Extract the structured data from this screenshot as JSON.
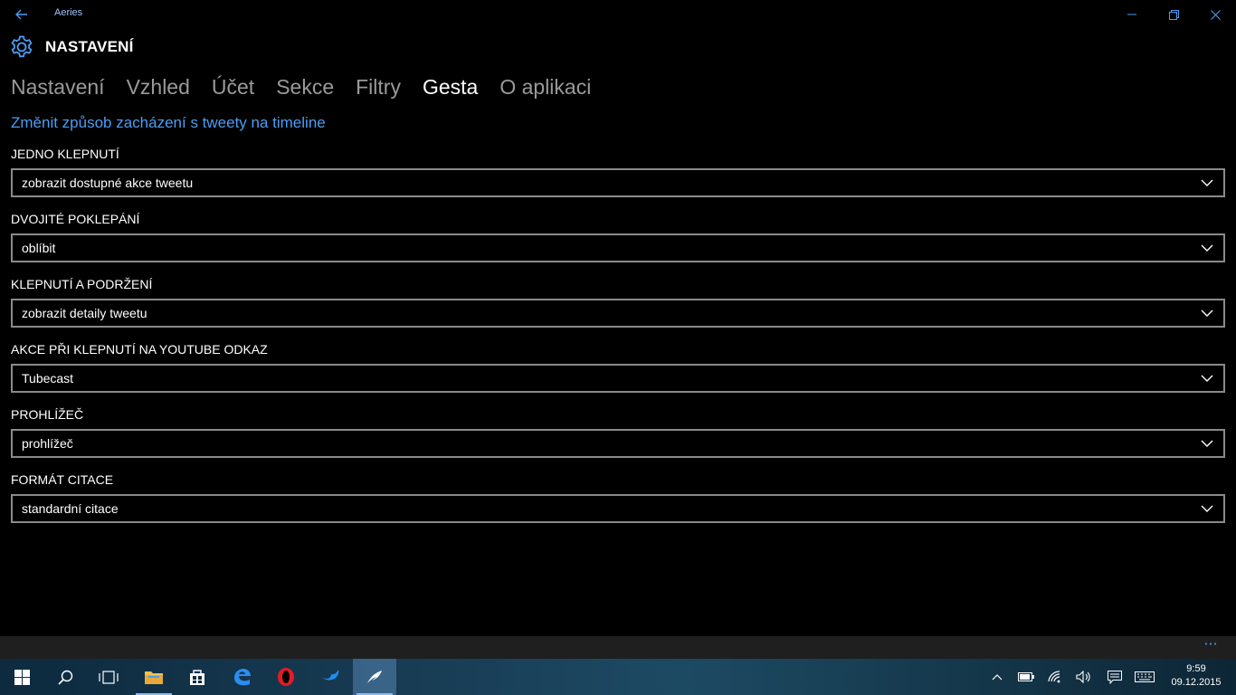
{
  "window": {
    "title": "Aeries"
  },
  "header": {
    "title": "NASTAVENÍ"
  },
  "tabs": [
    {
      "label": "Nastavení",
      "active": false
    },
    {
      "label": "Vzhled",
      "active": false
    },
    {
      "label": "Účet",
      "active": false
    },
    {
      "label": "Sekce",
      "active": false
    },
    {
      "label": "Filtry",
      "active": false
    },
    {
      "label": "Gesta",
      "active": true
    },
    {
      "label": "O aplikaci",
      "active": false
    }
  ],
  "section": {
    "link": "Změnit způsob zacházení s tweety na timeline"
  },
  "settings": [
    {
      "label": "JEDNO KLEPNUTÍ",
      "value": "zobrazit dostupné akce tweetu"
    },
    {
      "label": "DVOJITÉ POKLEPÁNÍ",
      "value": "oblíbit"
    },
    {
      "label": "KLEPNUTÍ A PODRŽENÍ",
      "value": "zobrazit detaily tweetu"
    },
    {
      "label": "AKCE PŘI KLEPNUTÍ NA YOUTUBE ODKAZ",
      "value": "Tubecast"
    },
    {
      "label": "PROHLÍŽEČ",
      "value": "prohlížeč"
    },
    {
      "label": "FORMÁT CITACE",
      "value": "standardní citace"
    }
  ],
  "appbar": {
    "more": "···"
  },
  "taskbar": {
    "time": "9:59",
    "date": "09.12.2015"
  },
  "colors": {
    "accent": "#4d9cf4",
    "border": "#8a8a8a",
    "background": "#000000"
  }
}
